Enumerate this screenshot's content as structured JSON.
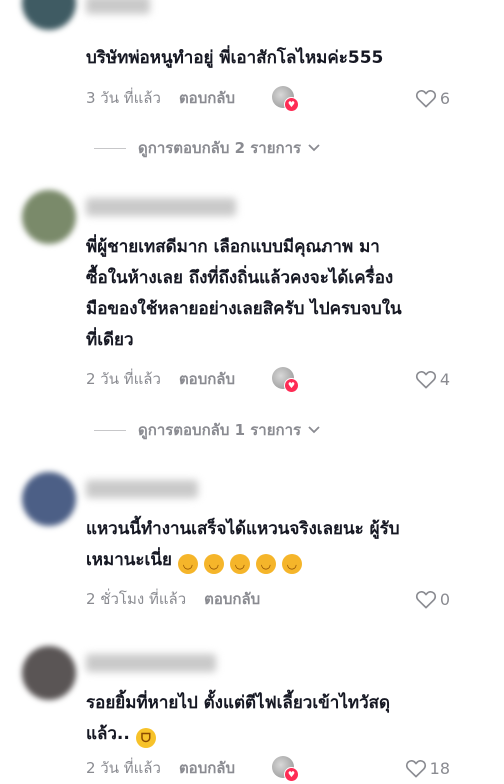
{
  "comments": [
    {
      "text": "บริษัทพ่อหนูทำอยู่ พี่เอาสักโลไหมค่ะ555",
      "time": "3 วัน ที่แล้ว",
      "reply_label": "ตอบกลับ",
      "likes": "6",
      "view_replies": "ดูการตอบกลับ 2 รายการ",
      "avatar_color": "#3f5b63"
    },
    {
      "text": "พี่ผู้ชายเทสดีมาก เลือกแบบมีคุณภาพ มา\nซื้อในห้างเลย ถึงที่ถึงถิ่นแล้วคงจะได้เครื่อง\nมือของใช้หลายอย่างเลยสิครับ ไปครบจบใน\nที่เดียว",
      "time": "2 วัน ที่แล้ว",
      "reply_label": "ตอบกลับ",
      "likes": "4",
      "view_replies": "ดูการตอบกลับ 1 รายการ",
      "avatar_color": "#7a8a6a"
    },
    {
      "text": "แหวนนี้ทำงานเสร็จได้แหวนจริงเลยนะ ผู้รับ\nเหมานะเนี่ย",
      "time": "2 ชั่วโมง ที่แล้ว",
      "reply_label": "ตอบกลับ",
      "likes": "0",
      "avatar_color": "#4c5f86"
    },
    {
      "text": "รอยยิ้มที่หายไป ตั้งแต่ตีไฟเลี้ยวเข้าไทวัสดุ\nแล้ว..",
      "time": "2 วัน ที่แล้ว",
      "reply_label": "ตอบกลับ",
      "likes": "18",
      "avatar_color": "#5a5555"
    }
  ],
  "colors": {
    "text": "#161823",
    "secondary": "#8a8b91",
    "creator_badge": "#fe2c55"
  },
  "icons": [
    "heart-outline-icon",
    "chevron-down-icon",
    "creator-avatar-icon",
    "smile-emoji-icon",
    "laugh-emoji-icon"
  ]
}
